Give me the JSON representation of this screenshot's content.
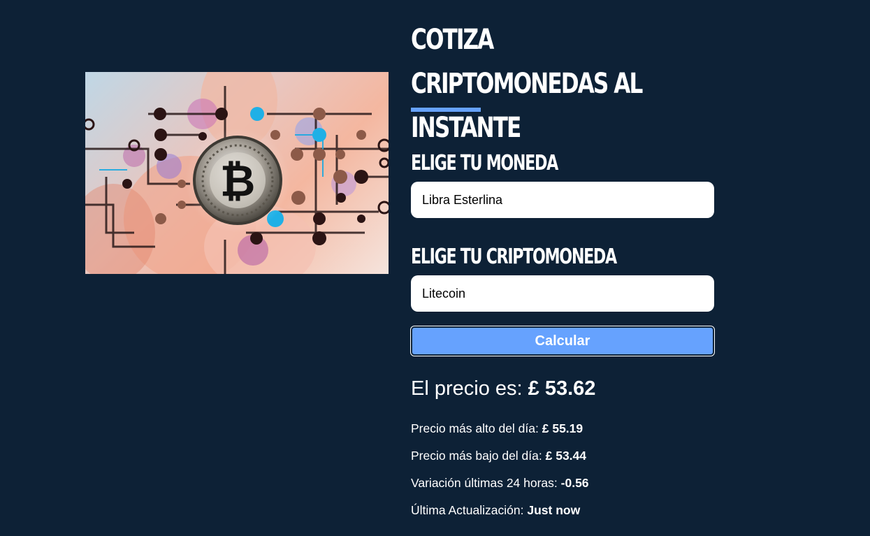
{
  "title": "Cotiza Criptomonedas al Instante",
  "form": {
    "currency_label": "Elige tu Moneda",
    "currency_value": "Libra Esterlina",
    "crypto_label": "Elige tu Criptomoneda",
    "crypto_value": "Litecoin",
    "submit_label": "Calcular"
  },
  "result": {
    "price_label": "El precio es:",
    "price_value": "£ 53.62",
    "high_label": "Precio más alto del día:",
    "high_value": "£ 55.19",
    "low_label": "Precio más bajo del día:",
    "low_value": "£ 53.44",
    "change_label": "Variación últimas 24 horas:",
    "change_value": "-0.56",
    "updated_label": "Última Actualización:",
    "updated_value": "Just now"
  },
  "image": {
    "icon": "bitcoin-coin"
  },
  "colors": {
    "background": "#0d2136",
    "accent": "#66a2fe",
    "text": "#ffffff"
  }
}
